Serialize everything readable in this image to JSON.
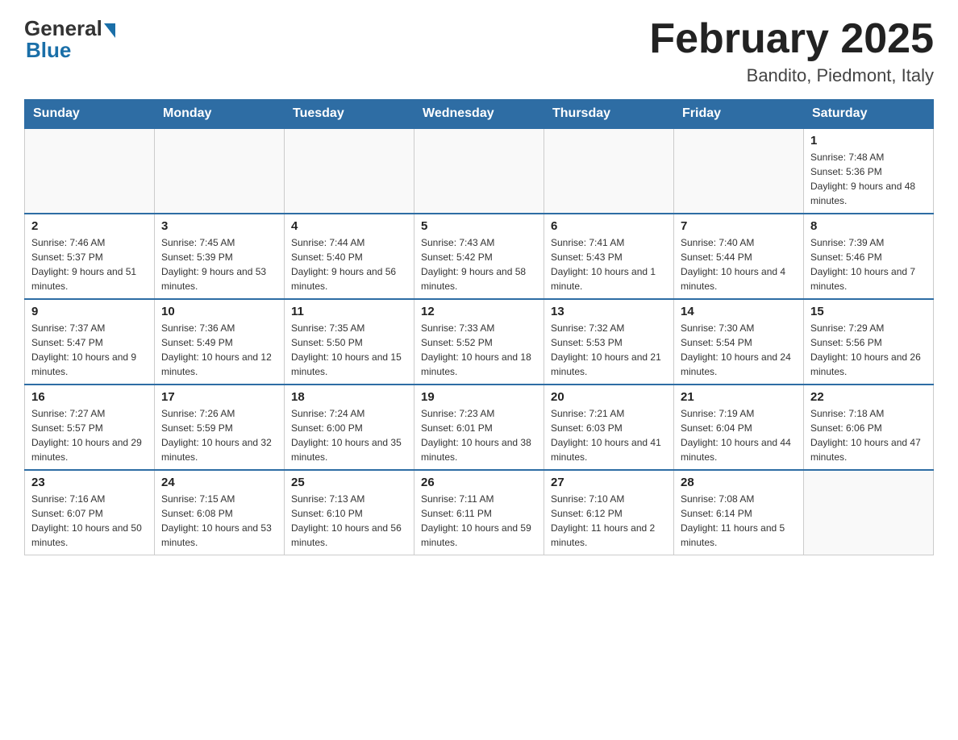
{
  "header": {
    "logo": {
      "general": "General",
      "blue": "Blue"
    },
    "title": "February 2025",
    "location": "Bandito, Piedmont, Italy"
  },
  "days_of_week": [
    "Sunday",
    "Monday",
    "Tuesday",
    "Wednesday",
    "Thursday",
    "Friday",
    "Saturday"
  ],
  "weeks": [
    [
      {
        "day": "",
        "info": ""
      },
      {
        "day": "",
        "info": ""
      },
      {
        "day": "",
        "info": ""
      },
      {
        "day": "",
        "info": ""
      },
      {
        "day": "",
        "info": ""
      },
      {
        "day": "",
        "info": ""
      },
      {
        "day": "1",
        "info": "Sunrise: 7:48 AM\nSunset: 5:36 PM\nDaylight: 9 hours and 48 minutes."
      }
    ],
    [
      {
        "day": "2",
        "info": "Sunrise: 7:46 AM\nSunset: 5:37 PM\nDaylight: 9 hours and 51 minutes."
      },
      {
        "day": "3",
        "info": "Sunrise: 7:45 AM\nSunset: 5:39 PM\nDaylight: 9 hours and 53 minutes."
      },
      {
        "day": "4",
        "info": "Sunrise: 7:44 AM\nSunset: 5:40 PM\nDaylight: 9 hours and 56 minutes."
      },
      {
        "day": "5",
        "info": "Sunrise: 7:43 AM\nSunset: 5:42 PM\nDaylight: 9 hours and 58 minutes."
      },
      {
        "day": "6",
        "info": "Sunrise: 7:41 AM\nSunset: 5:43 PM\nDaylight: 10 hours and 1 minute."
      },
      {
        "day": "7",
        "info": "Sunrise: 7:40 AM\nSunset: 5:44 PM\nDaylight: 10 hours and 4 minutes."
      },
      {
        "day": "8",
        "info": "Sunrise: 7:39 AM\nSunset: 5:46 PM\nDaylight: 10 hours and 7 minutes."
      }
    ],
    [
      {
        "day": "9",
        "info": "Sunrise: 7:37 AM\nSunset: 5:47 PM\nDaylight: 10 hours and 9 minutes."
      },
      {
        "day": "10",
        "info": "Sunrise: 7:36 AM\nSunset: 5:49 PM\nDaylight: 10 hours and 12 minutes."
      },
      {
        "day": "11",
        "info": "Sunrise: 7:35 AM\nSunset: 5:50 PM\nDaylight: 10 hours and 15 minutes."
      },
      {
        "day": "12",
        "info": "Sunrise: 7:33 AM\nSunset: 5:52 PM\nDaylight: 10 hours and 18 minutes."
      },
      {
        "day": "13",
        "info": "Sunrise: 7:32 AM\nSunset: 5:53 PM\nDaylight: 10 hours and 21 minutes."
      },
      {
        "day": "14",
        "info": "Sunrise: 7:30 AM\nSunset: 5:54 PM\nDaylight: 10 hours and 24 minutes."
      },
      {
        "day": "15",
        "info": "Sunrise: 7:29 AM\nSunset: 5:56 PM\nDaylight: 10 hours and 26 minutes."
      }
    ],
    [
      {
        "day": "16",
        "info": "Sunrise: 7:27 AM\nSunset: 5:57 PM\nDaylight: 10 hours and 29 minutes."
      },
      {
        "day": "17",
        "info": "Sunrise: 7:26 AM\nSunset: 5:59 PM\nDaylight: 10 hours and 32 minutes."
      },
      {
        "day": "18",
        "info": "Sunrise: 7:24 AM\nSunset: 6:00 PM\nDaylight: 10 hours and 35 minutes."
      },
      {
        "day": "19",
        "info": "Sunrise: 7:23 AM\nSunset: 6:01 PM\nDaylight: 10 hours and 38 minutes."
      },
      {
        "day": "20",
        "info": "Sunrise: 7:21 AM\nSunset: 6:03 PM\nDaylight: 10 hours and 41 minutes."
      },
      {
        "day": "21",
        "info": "Sunrise: 7:19 AM\nSunset: 6:04 PM\nDaylight: 10 hours and 44 minutes."
      },
      {
        "day": "22",
        "info": "Sunrise: 7:18 AM\nSunset: 6:06 PM\nDaylight: 10 hours and 47 minutes."
      }
    ],
    [
      {
        "day": "23",
        "info": "Sunrise: 7:16 AM\nSunset: 6:07 PM\nDaylight: 10 hours and 50 minutes."
      },
      {
        "day": "24",
        "info": "Sunrise: 7:15 AM\nSunset: 6:08 PM\nDaylight: 10 hours and 53 minutes."
      },
      {
        "day": "25",
        "info": "Sunrise: 7:13 AM\nSunset: 6:10 PM\nDaylight: 10 hours and 56 minutes."
      },
      {
        "day": "26",
        "info": "Sunrise: 7:11 AM\nSunset: 6:11 PM\nDaylight: 10 hours and 59 minutes."
      },
      {
        "day": "27",
        "info": "Sunrise: 7:10 AM\nSunset: 6:12 PM\nDaylight: 11 hours and 2 minutes."
      },
      {
        "day": "28",
        "info": "Sunrise: 7:08 AM\nSunset: 6:14 PM\nDaylight: 11 hours and 5 minutes."
      },
      {
        "day": "",
        "info": ""
      }
    ]
  ]
}
